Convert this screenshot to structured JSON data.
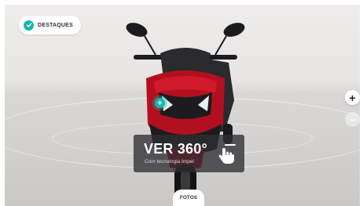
{
  "highlights": {
    "label": "DESTAQUES",
    "icon": "check-circle-icon"
  },
  "viewer": {
    "hotspot_symbol": "+",
    "zoom_in_symbol": "+",
    "zoom_out_symbol": "−"
  },
  "view360": {
    "title": "VER 360°",
    "subtitle": "Com tecnologia Impel",
    "icon": "hand-drag-icon"
  },
  "photos": {
    "label": "FOTOS"
  },
  "colors": {
    "accent_teal": "#16b7a8",
    "scooter_red": "#b3101f",
    "scooter_black": "#1c1c1e"
  }
}
